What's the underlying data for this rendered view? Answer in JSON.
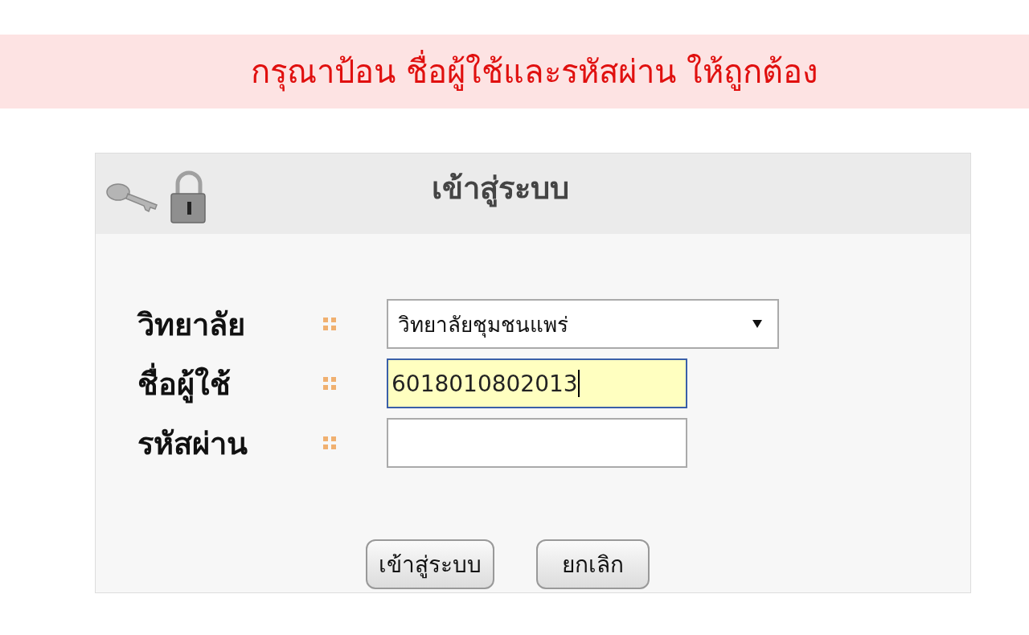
{
  "alert": {
    "message": "กรุณาป้อน ชื่อผู้ใช้และรหัสผ่าน ให้ถูกต้อง"
  },
  "login_panel": {
    "title": "เข้าสู่ระบบ",
    "fields": [
      {
        "kind": "select",
        "label": "วิทยาลัย",
        "value": "วิทยาลัยชุมชนแพร่",
        "focused": false
      },
      {
        "kind": "text",
        "label": "ชื่อผู้ใช้",
        "value": "6018010802013",
        "focused": true
      },
      {
        "kind": "password",
        "label": "รหัสผ่าน",
        "focused": false
      }
    ],
    "buttons": [
      "เข้าสู่ระบบ",
      "ยกเลิก"
    ]
  }
}
